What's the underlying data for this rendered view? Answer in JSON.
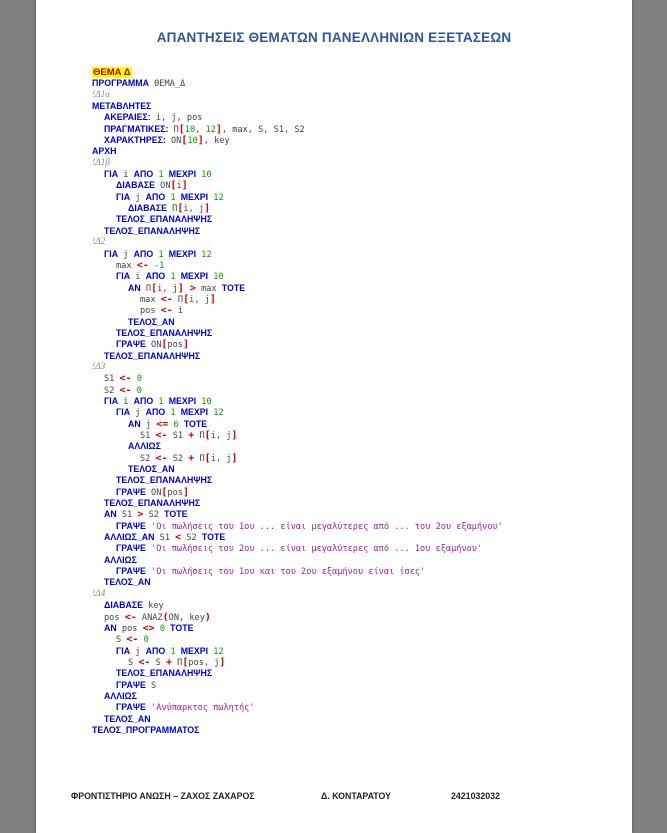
{
  "document": {
    "title": "ΑΠΑΝΤΗΣΕΙΣ ΘΕΜΑΤΩΝ ΠΑΝΕΛΛΗΝΙΩΝ ΕΞΕΤΑΣΕΩΝ",
    "section": "ΘΕΜΑ Δ"
  },
  "code_lines": [
    {
      "indent": 0,
      "tokens": [
        [
          "kw",
          "ΠΡΟΓΡΑΜΜΑ"
        ],
        [
          "id",
          " ΘΕΜΑ_Δ"
        ]
      ]
    },
    {
      "indent": 0,
      "tokens": [
        [
          "cm",
          "!Δ1α"
        ]
      ]
    },
    {
      "indent": 0,
      "tokens": [
        [
          "kw",
          "ΜΕΤΑΒΛΗΤΕΣ"
        ]
      ]
    },
    {
      "indent": 1,
      "tokens": [
        [
          "kw",
          "ΑΚΕΡΑΙΕΣ:"
        ],
        [
          "id",
          " i, j, pos"
        ]
      ]
    },
    {
      "indent": 1,
      "tokens": [
        [
          "kw",
          "ΠΡΑΓΜΑΤΙΚΕΣ:"
        ],
        [
          "id",
          " Π"
        ],
        [
          "op",
          "["
        ],
        [
          "num",
          "10"
        ],
        [
          "id",
          ", "
        ],
        [
          "num",
          "12"
        ],
        [
          "op",
          "]"
        ],
        [
          "id",
          ", max, S, S1, S2"
        ]
      ]
    },
    {
      "indent": 1,
      "tokens": [
        [
          "kw",
          "ΧΑΡΑΚΤΗΡΕΣ:"
        ],
        [
          "id",
          " ON"
        ],
        [
          "op",
          "["
        ],
        [
          "num",
          "10"
        ],
        [
          "op",
          "]"
        ],
        [
          "id",
          ", key"
        ]
      ]
    },
    {
      "indent": 0,
      "tokens": [
        [
          "kw",
          "ΑΡΧΗ"
        ]
      ]
    },
    {
      "indent": 0,
      "tokens": [
        [
          "cm",
          "!Δ1β"
        ]
      ]
    },
    {
      "indent": 1,
      "tokens": [
        [
          "kw",
          "ΓΙΑ"
        ],
        [
          "id",
          " i "
        ],
        [
          "kw",
          "ΑΠΟ"
        ],
        [
          "num",
          " 1 "
        ],
        [
          "kw",
          "ΜΕΧΡΙ"
        ],
        [
          "num",
          " 10"
        ]
      ]
    },
    {
      "indent": 2,
      "tokens": [
        [
          "kw",
          "ΔΙΑΒΑΣΕ"
        ],
        [
          "id",
          " ON"
        ],
        [
          "op",
          "["
        ],
        [
          "id",
          "i"
        ],
        [
          "op",
          "]"
        ]
      ]
    },
    {
      "indent": 2,
      "tokens": [
        [
          "kw",
          "ΓΙΑ"
        ],
        [
          "id",
          " j "
        ],
        [
          "kw",
          "ΑΠΟ"
        ],
        [
          "num",
          " 1 "
        ],
        [
          "kw",
          "ΜΕΧΡΙ"
        ],
        [
          "num",
          " 12"
        ]
      ]
    },
    {
      "indent": 3,
      "tokens": [
        [
          "kw",
          "ΔΙΑΒΑΣΕ"
        ],
        [
          "id",
          " Π"
        ],
        [
          "op",
          "["
        ],
        [
          "id",
          "i, j"
        ],
        [
          "op",
          "]"
        ]
      ]
    },
    {
      "indent": 2,
      "tokens": [
        [
          "kw",
          "ΤΕΛΟΣ_ΕΠΑΝΑΛΗΨΗΣ"
        ]
      ]
    },
    {
      "indent": 1,
      "tokens": [
        [
          "kw",
          "ΤΕΛΟΣ_ΕΠΑΝΑΛΗΨΗΣ"
        ]
      ]
    },
    {
      "indent": 0,
      "tokens": [
        [
          "cm",
          "!Δ2"
        ]
      ]
    },
    {
      "indent": 1,
      "tokens": [
        [
          "kw",
          "ΓΙΑ"
        ],
        [
          "id",
          " j "
        ],
        [
          "kw",
          "ΑΠΟ"
        ],
        [
          "num",
          " 1 "
        ],
        [
          "kw",
          "ΜΕΧΡΙ"
        ],
        [
          "num",
          " 12"
        ]
      ]
    },
    {
      "indent": 2,
      "tokens": [
        [
          "id",
          "max "
        ],
        [
          "op",
          "<-"
        ],
        [
          "num",
          " -1"
        ]
      ]
    },
    {
      "indent": 2,
      "tokens": [
        [
          "kw",
          "ΓΙΑ"
        ],
        [
          "id",
          " i "
        ],
        [
          "kw",
          "ΑΠΟ"
        ],
        [
          "num",
          " 1 "
        ],
        [
          "kw",
          "ΜΕΧΡΙ"
        ],
        [
          "num",
          " 10"
        ]
      ]
    },
    {
      "indent": 3,
      "tokens": [
        [
          "kw",
          "ΑΝ"
        ],
        [
          "id",
          " Π"
        ],
        [
          "op",
          "["
        ],
        [
          "id",
          "i, j"
        ],
        [
          "op",
          "]"
        ],
        [
          "op",
          " >"
        ],
        [
          "id",
          " max "
        ],
        [
          "kw",
          "ΤΟΤΕ"
        ]
      ]
    },
    {
      "indent": 4,
      "tokens": [
        [
          "id",
          "max "
        ],
        [
          "op",
          "<-"
        ],
        [
          "id",
          " Π"
        ],
        [
          "op",
          "["
        ],
        [
          "id",
          "i, j"
        ],
        [
          "op",
          "]"
        ]
      ]
    },
    {
      "indent": 4,
      "tokens": [
        [
          "id",
          "pos "
        ],
        [
          "op",
          "<-"
        ],
        [
          "id",
          " i"
        ]
      ]
    },
    {
      "indent": 3,
      "tokens": [
        [
          "kw",
          "ΤΕΛΟΣ_ΑΝ"
        ]
      ]
    },
    {
      "indent": 2,
      "tokens": [
        [
          "kw",
          "ΤΕΛΟΣ_ΕΠΑΝΑΛΗΨΗΣ"
        ]
      ]
    },
    {
      "indent": 2,
      "tokens": [
        [
          "kw",
          "ΓΡΑΨΕ"
        ],
        [
          "id",
          " ON"
        ],
        [
          "op",
          "["
        ],
        [
          "id",
          "pos"
        ],
        [
          "op",
          "]"
        ]
      ]
    },
    {
      "indent": 1,
      "tokens": [
        [
          "kw",
          "ΤΕΛΟΣ_ΕΠΑΝΑΛΗΨΗΣ"
        ]
      ]
    },
    {
      "indent": 0,
      "tokens": [
        [
          "cm",
          "!Δ3"
        ]
      ]
    },
    {
      "indent": 1,
      "tokens": [
        [
          "id",
          "S1 "
        ],
        [
          "op",
          "<-"
        ],
        [
          "num",
          " 0"
        ]
      ]
    },
    {
      "indent": 1,
      "tokens": [
        [
          "id",
          "S2 "
        ],
        [
          "op",
          "<-"
        ],
        [
          "num",
          " 0"
        ]
      ]
    },
    {
      "indent": 1,
      "tokens": [
        [
          "kw",
          "ΓΙΑ"
        ],
        [
          "id",
          " i "
        ],
        [
          "kw",
          "ΑΠΟ"
        ],
        [
          "num",
          " 1 "
        ],
        [
          "kw",
          "ΜΕΧΡΙ"
        ],
        [
          "num",
          " 10"
        ]
      ]
    },
    {
      "indent": 2,
      "tokens": [
        [
          "kw",
          "ΓΙΑ"
        ],
        [
          "id",
          " j "
        ],
        [
          "kw",
          "ΑΠΟ"
        ],
        [
          "num",
          " 1 "
        ],
        [
          "kw",
          "ΜΕΧΡΙ"
        ],
        [
          "num",
          " 12"
        ]
      ]
    },
    {
      "indent": 3,
      "tokens": [
        [
          "kw",
          "ΑΝ"
        ],
        [
          "id",
          " j "
        ],
        [
          "op",
          "<="
        ],
        [
          "num",
          " 6 "
        ],
        [
          "kw",
          "ΤΟΤΕ"
        ]
      ]
    },
    {
      "indent": 4,
      "tokens": [
        [
          "id",
          "S1 "
        ],
        [
          "op",
          "<-"
        ],
        [
          "id",
          " S1 "
        ],
        [
          "op",
          "+"
        ],
        [
          "id",
          " Π"
        ],
        [
          "op",
          "["
        ],
        [
          "id",
          "i, j"
        ],
        [
          "op",
          "]"
        ]
      ]
    },
    {
      "indent": 3,
      "tokens": [
        [
          "kw",
          "ΑΛΛΙΩΣ"
        ]
      ]
    },
    {
      "indent": 4,
      "tokens": [
        [
          "id",
          "S2 "
        ],
        [
          "op",
          "<-"
        ],
        [
          "id",
          " S2 "
        ],
        [
          "op",
          "+"
        ],
        [
          "id",
          " Π"
        ],
        [
          "op",
          "["
        ],
        [
          "id",
          "i, j"
        ],
        [
          "op",
          "]"
        ]
      ]
    },
    {
      "indent": 3,
      "tokens": [
        [
          "kw",
          "ΤΕΛΟΣ_ΑΝ"
        ]
      ]
    },
    {
      "indent": 2,
      "tokens": [
        [
          "kw",
          "ΤΕΛΟΣ_ΕΠΑΝΑΛΗΨΗΣ"
        ]
      ]
    },
    {
      "indent": 2,
      "tokens": [
        [
          "kw",
          "ΓΡΑΨΕ"
        ],
        [
          "id",
          " ON"
        ],
        [
          "op",
          "["
        ],
        [
          "id",
          "pos"
        ],
        [
          "op",
          "]"
        ]
      ]
    },
    {
      "indent": 1,
      "tokens": [
        [
          "kw",
          "ΤΕΛΟΣ_ΕΠΑΝΑΛΗΨΗΣ"
        ]
      ]
    },
    {
      "indent": 1,
      "tokens": [
        [
          "kw",
          "ΑΝ"
        ],
        [
          "id",
          " S1 "
        ],
        [
          "op",
          ">"
        ],
        [
          "id",
          " S2 "
        ],
        [
          "kw",
          "ΤΟΤΕ"
        ]
      ]
    },
    {
      "indent": 2,
      "tokens": [
        [
          "kw",
          "ΓΡΑΨΕ"
        ],
        [
          "str",
          " 'Οι πωλήσεις του 1ου ... είναι μεγαλύτερες από ... του 2ου εξαμήνου'"
        ]
      ]
    },
    {
      "indent": 1,
      "tokens": [
        [
          "kw",
          "ΑΛΛΙΩΣ_ΑΝ"
        ],
        [
          "id",
          " S1 "
        ],
        [
          "op",
          "<"
        ],
        [
          "id",
          " S2 "
        ],
        [
          "kw",
          "ΤΟΤΕ"
        ]
      ]
    },
    {
      "indent": 2,
      "tokens": [
        [
          "kw",
          "ΓΡΑΨΕ"
        ],
        [
          "str",
          " 'Οι πωλήσεις του 2ου ... είναι μεγαλύτερες από ... 1ου εξαμήνου'"
        ]
      ]
    },
    {
      "indent": 1,
      "tokens": [
        [
          "kw",
          "ΑΛΛΙΩΣ"
        ]
      ]
    },
    {
      "indent": 2,
      "tokens": [
        [
          "kw",
          "ΓΡΑΨΕ"
        ],
        [
          "str",
          " 'Οι πωλήσεις του 1ου και του 2ου εξαμήνου είναι ίσες'"
        ]
      ]
    },
    {
      "indent": 1,
      "tokens": [
        [
          "kw",
          "ΤΕΛΟΣ_ΑΝ"
        ]
      ]
    },
    {
      "indent": 0,
      "tokens": [
        [
          "cm",
          "!Δ4"
        ]
      ]
    },
    {
      "indent": 1,
      "tokens": [
        [
          "kw",
          "ΔΙΑΒΑΣΕ"
        ],
        [
          "id",
          " key"
        ]
      ]
    },
    {
      "indent": 1,
      "tokens": [
        [
          "id",
          "pos "
        ],
        [
          "op",
          "<-"
        ],
        [
          "id",
          " ΑΝΑΖ"
        ],
        [
          "op",
          "("
        ],
        [
          "id",
          "ON, key"
        ],
        [
          "op",
          ")"
        ]
      ]
    },
    {
      "indent": 1,
      "tokens": [
        [
          "kw",
          "ΑΝ"
        ],
        [
          "id",
          " pos "
        ],
        [
          "op",
          "<>"
        ],
        [
          "num",
          " 0 "
        ],
        [
          "kw",
          "ΤΟΤΕ"
        ]
      ]
    },
    {
      "indent": 2,
      "tokens": [
        [
          "id",
          "S "
        ],
        [
          "op",
          "<-"
        ],
        [
          "num",
          " 0"
        ]
      ]
    },
    {
      "indent": 2,
      "tokens": [
        [
          "kw",
          "ΓΙΑ"
        ],
        [
          "id",
          " j "
        ],
        [
          "kw",
          "ΑΠΟ"
        ],
        [
          "num",
          " 1 "
        ],
        [
          "kw",
          "ΜΕΧΡΙ"
        ],
        [
          "num",
          " 12"
        ]
      ]
    },
    {
      "indent": 3,
      "tokens": [
        [
          "id",
          "S "
        ],
        [
          "op",
          "<-"
        ],
        [
          "id",
          " S "
        ],
        [
          "op",
          "+"
        ],
        [
          "id",
          " Π"
        ],
        [
          "op",
          "["
        ],
        [
          "id",
          "pos, j"
        ],
        [
          "op",
          "]"
        ]
      ]
    },
    {
      "indent": 2,
      "tokens": [
        [
          "kw",
          "ΤΕΛΟΣ_ΕΠΑΝΑΛΗΨΗΣ"
        ]
      ]
    },
    {
      "indent": 2,
      "tokens": [
        [
          "kw",
          "ΓΡΑΨΕ"
        ],
        [
          "id",
          " S"
        ]
      ]
    },
    {
      "indent": 1,
      "tokens": [
        [
          "kw",
          "ΑΛΛΙΩΣ"
        ]
      ]
    },
    {
      "indent": 2,
      "tokens": [
        [
          "kw",
          "ΓΡΑΨΕ"
        ],
        [
          "str",
          " 'Ανύπαρκτος πωλητής'"
        ]
      ]
    },
    {
      "indent": 1,
      "tokens": [
        [
          "kw",
          "ΤΕΛΟΣ_ΑΝ"
        ]
      ]
    },
    {
      "indent": 0,
      "tokens": [
        [
          "kw",
          "ΤΕΛΟΣ_ΠΡΟΓΡΑΜΜΑΤΟΣ"
        ]
      ]
    }
  ],
  "footer": {
    "left": "ΦΡΟΝΤΙΣΤΗΡΙΟ ΑΝΩΣΗ – ΖΑΧΟΣ ΖΑΧΑΡΟΣ",
    "middle": "Δ. ΚΟΝΤΑΡΑΤΟΥ",
    "right": "2421032032"
  }
}
